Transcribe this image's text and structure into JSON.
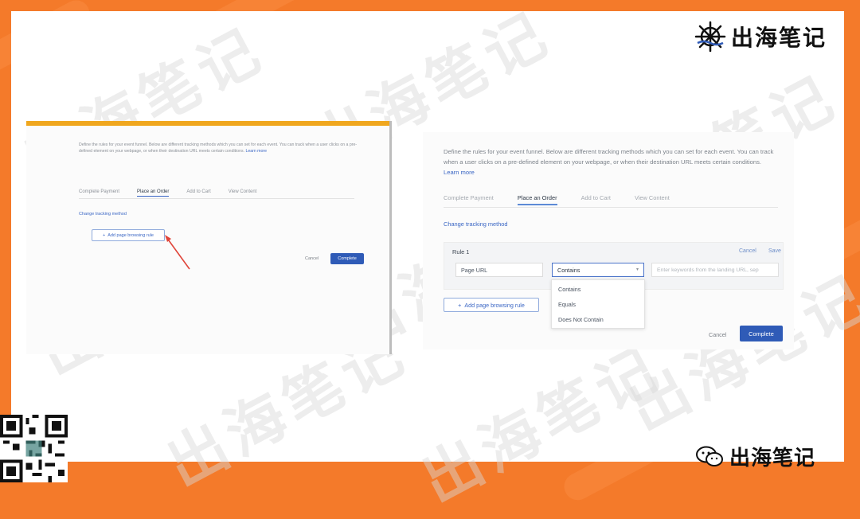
{
  "brand": {
    "logo_text": "出海笔记",
    "wechat_text": "出海笔记",
    "watermark_text": "出海笔记",
    "frame_color": "#f47a2a",
    "accent_orange": "#f0a71e",
    "primary_blue": "#2f5bb7"
  },
  "left_panel": {
    "description": "Define the rules for your event funnel. Below are different tracking methods which you can set for each event. You can track when a user clicks on a pre-defined element on your webpage, or when their destination URL meets certain conditions.",
    "learn_more": "Learn more",
    "tabs": [
      "Complete Payment",
      "Place an Order",
      "Add to Cart",
      "View Content"
    ],
    "active_tab": "Place an Order",
    "change_method": "Change tracking method",
    "add_rule_button": "Add page browsing rule",
    "cancel": "Cancel",
    "complete": "Complete"
  },
  "right_panel": {
    "description": "Define the rules for your event funnel. Below are different tracking methods which you can set for each event. You can track when a user clicks on a pre-defined element on your webpage, or when their destination URL meets certain conditions.",
    "learn_more": "Learn more",
    "tabs": [
      "Complete Payment",
      "Place an Order",
      "Add to Cart",
      "View Content"
    ],
    "active_tab": "Place an Order",
    "change_method": "Change tracking method",
    "rule": {
      "title": "Rule 1",
      "cancel": "Cancel",
      "save": "Save",
      "field_select": "Page URL",
      "operator_select": "Contains",
      "keyword_placeholder": "Enter keywords from the landing URL, sep"
    },
    "operator_options": [
      "Contains",
      "Equals",
      "Does Not Contain"
    ],
    "add_rule_button": "Add page browsing rule",
    "cancel": "Cancel",
    "complete": "Complete"
  }
}
